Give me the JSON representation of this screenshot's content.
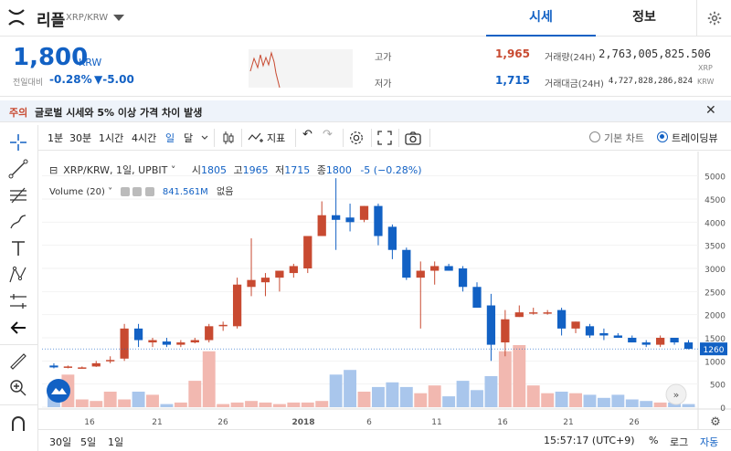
{
  "header": {
    "coin_name": "리플",
    "pair": "XRP/KRW",
    "tabs": [
      "시세",
      "정보"
    ]
  },
  "ticker": {
    "price": "1,800",
    "unit": "KRW",
    "prev_label": "전일대비",
    "change_pct": "-0.28%",
    "change_abs": "▼-5.00",
    "high_label": "고가",
    "high_value": "1,965",
    "low_label": "저가",
    "low_value": "1,715",
    "volume_label": "거래량(24H)",
    "volume_value": "2,763,005,825.506",
    "volume_unit": "XRP",
    "amount_label": "거래대금(24H)",
    "amount_value": "4,727,828,286,824",
    "amount_unit": "KRW"
  },
  "notice": {
    "tag": "주의",
    "text": "글로벌 시세와 5% 이상 가격 차이 발생"
  },
  "toolbar": {
    "intervals": [
      "1분",
      "30분",
      "1시간",
      "4시간",
      "일",
      "달"
    ],
    "active_interval": "일",
    "indicator_label": "지표",
    "view_basic": "기본 차트",
    "view_tv": "트레이딩뷰"
  },
  "legend": {
    "symbol": "XRP/KRW, 1일, UPBIT",
    "open_label": "시",
    "open": "1805",
    "high_label": "고",
    "high": "1965",
    "low_label": "저",
    "low": "1715",
    "close_label": "종",
    "close": "1800",
    "change": "-5 (−0.28%)",
    "volume_label": "Volume (20)",
    "volume_value": "841.561M",
    "volume_extra": "없음"
  },
  "bottom": {
    "ranges": [
      "30일",
      "5일",
      "1일"
    ],
    "time": "15:57:17 (UTC+9)",
    "percent": "%",
    "log": "로그",
    "auto": "자동"
  },
  "colors": {
    "up": "#c84a31",
    "down": "#1261c4",
    "up_vol": "#f2b8b0",
    "down_vol": "#a9c6ec"
  },
  "chart_data": {
    "type": "candlestick",
    "x_ticks": [
      "16",
      "21",
      "26",
      "2018",
      "6",
      "11",
      "16",
      "21",
      "26"
    ],
    "y_ticks": [
      "5000",
      "4500",
      "4000",
      "3500",
      "3000",
      "2500",
      "2000",
      "1500",
      "1000",
      "500",
      "0"
    ],
    "ylim": [
      0,
      5250
    ],
    "current_price_label": "1260",
    "candles": [
      {
        "o": 900,
        "h": 950,
        "l": 840,
        "c": 860
      },
      {
        "o": 870,
        "h": 900,
        "l": 840,
        "c": 880
      },
      {
        "o": 860,
        "h": 880,
        "l": 840,
        "c": 860
      },
      {
        "o": 880,
        "h": 1000,
        "l": 870,
        "c": 950
      },
      {
        "o": 1000,
        "h": 1100,
        "l": 950,
        "c": 1020
      },
      {
        "o": 1050,
        "h": 1800,
        "l": 1000,
        "c": 1700
      },
      {
        "o": 1700,
        "h": 1800,
        "l": 1300,
        "c": 1450
      },
      {
        "o": 1400,
        "h": 1500,
        "l": 1300,
        "c": 1450
      },
      {
        "o": 1420,
        "h": 1500,
        "l": 1300,
        "c": 1350
      },
      {
        "o": 1350,
        "h": 1450,
        "l": 1300,
        "c": 1400
      },
      {
        "o": 1400,
        "h": 1500,
        "l": 1380,
        "c": 1450
      },
      {
        "o": 1450,
        "h": 1800,
        "l": 1400,
        "c": 1750
      },
      {
        "o": 1750,
        "h": 1850,
        "l": 1650,
        "c": 1780
      },
      {
        "o": 1750,
        "h": 2800,
        "l": 1700,
        "c": 2650
      },
      {
        "o": 2600,
        "h": 3650,
        "l": 2400,
        "c": 2750
      },
      {
        "o": 2700,
        "h": 2900,
        "l": 2400,
        "c": 2800
      },
      {
        "o": 2800,
        "h": 2900,
        "l": 2500,
        "c": 2950
      },
      {
        "o": 2900,
        "h": 3100,
        "l": 2800,
        "c": 3050
      },
      {
        "o": 3000,
        "h": 3300,
        "l": 2900,
        "c": 3700
      },
      {
        "o": 3700,
        "h": 4450,
        "l": 3700,
        "c": 4150
      },
      {
        "o": 4150,
        "h": 4950,
        "l": 3400,
        "c": 4050
      },
      {
        "o": 4100,
        "h": 4400,
        "l": 3800,
        "c": 4000
      },
      {
        "o": 4050,
        "h": 4350,
        "l": 4000,
        "c": 4350
      },
      {
        "o": 4350,
        "h": 4400,
        "l": 3500,
        "c": 3700
      },
      {
        "o": 3900,
        "h": 3950,
        "l": 3200,
        "c": 3400
      },
      {
        "o": 3400,
        "h": 3450,
        "l": 2750,
        "c": 2800
      },
      {
        "o": 2800,
        "h": 3150,
        "l": 1700,
        "c": 2950
      },
      {
        "o": 2950,
        "h": 3150,
        "l": 2650,
        "c": 3050
      },
      {
        "o": 3050,
        "h": 3100,
        "l": 2950,
        "c": 2950
      },
      {
        "o": 3000,
        "h": 3050,
        "l": 2500,
        "c": 2600
      },
      {
        "o": 2600,
        "h": 2700,
        "l": 2150,
        "c": 2150
      },
      {
        "o": 2200,
        "h": 2450,
        "l": 1000,
        "c": 1350
      },
      {
        "o": 1400,
        "h": 2100,
        "l": 1100,
        "c": 1900
      },
      {
        "o": 1950,
        "h": 2200,
        "l": 1950,
        "c": 2050
      },
      {
        "o": 2050,
        "h": 2150,
        "l": 2000,
        "c": 2050
      },
      {
        "o": 2050,
        "h": 2100,
        "l": 2000,
        "c": 2050
      },
      {
        "o": 2100,
        "h": 2150,
        "l": 1550,
        "c": 1700
      },
      {
        "o": 1700,
        "h": 1850,
        "l": 1600,
        "c": 1850
      },
      {
        "o": 1750,
        "h": 1800,
        "l": 1500,
        "c": 1550
      },
      {
        "o": 1600,
        "h": 1700,
        "l": 1450,
        "c": 1550
      },
      {
        "o": 1550,
        "h": 1600,
        "l": 1500,
        "c": 1500
      },
      {
        "o": 1500,
        "h": 1550,
        "l": 1400,
        "c": 1400
      },
      {
        "o": 1400,
        "h": 1450,
        "l": 1300,
        "c": 1350
      },
      {
        "o": 1350,
        "h": 1550,
        "l": 1300,
        "c": 1500
      },
      {
        "o": 1500,
        "h": 1500,
        "l": 1350,
        "c": 1400
      },
      {
        "o": 1400,
        "h": 1450,
        "l": 1250,
        "c": 1260
      }
    ],
    "volume": [
      800,
      2100,
      500,
      400,
      1000,
      500,
      1000,
      800,
      200,
      300,
      1700,
      3600,
      200,
      300,
      400,
      300,
      200,
      300,
      300,
      400,
      2100,
      2400,
      1000,
      1300,
      1600,
      1300,
      900,
      1400,
      700,
      1700,
      1100,
      2000,
      3600,
      4000,
      1400,
      900,
      1000,
      900,
      800,
      600,
      800,
      500,
      400,
      300,
      300,
      200
    ]
  }
}
